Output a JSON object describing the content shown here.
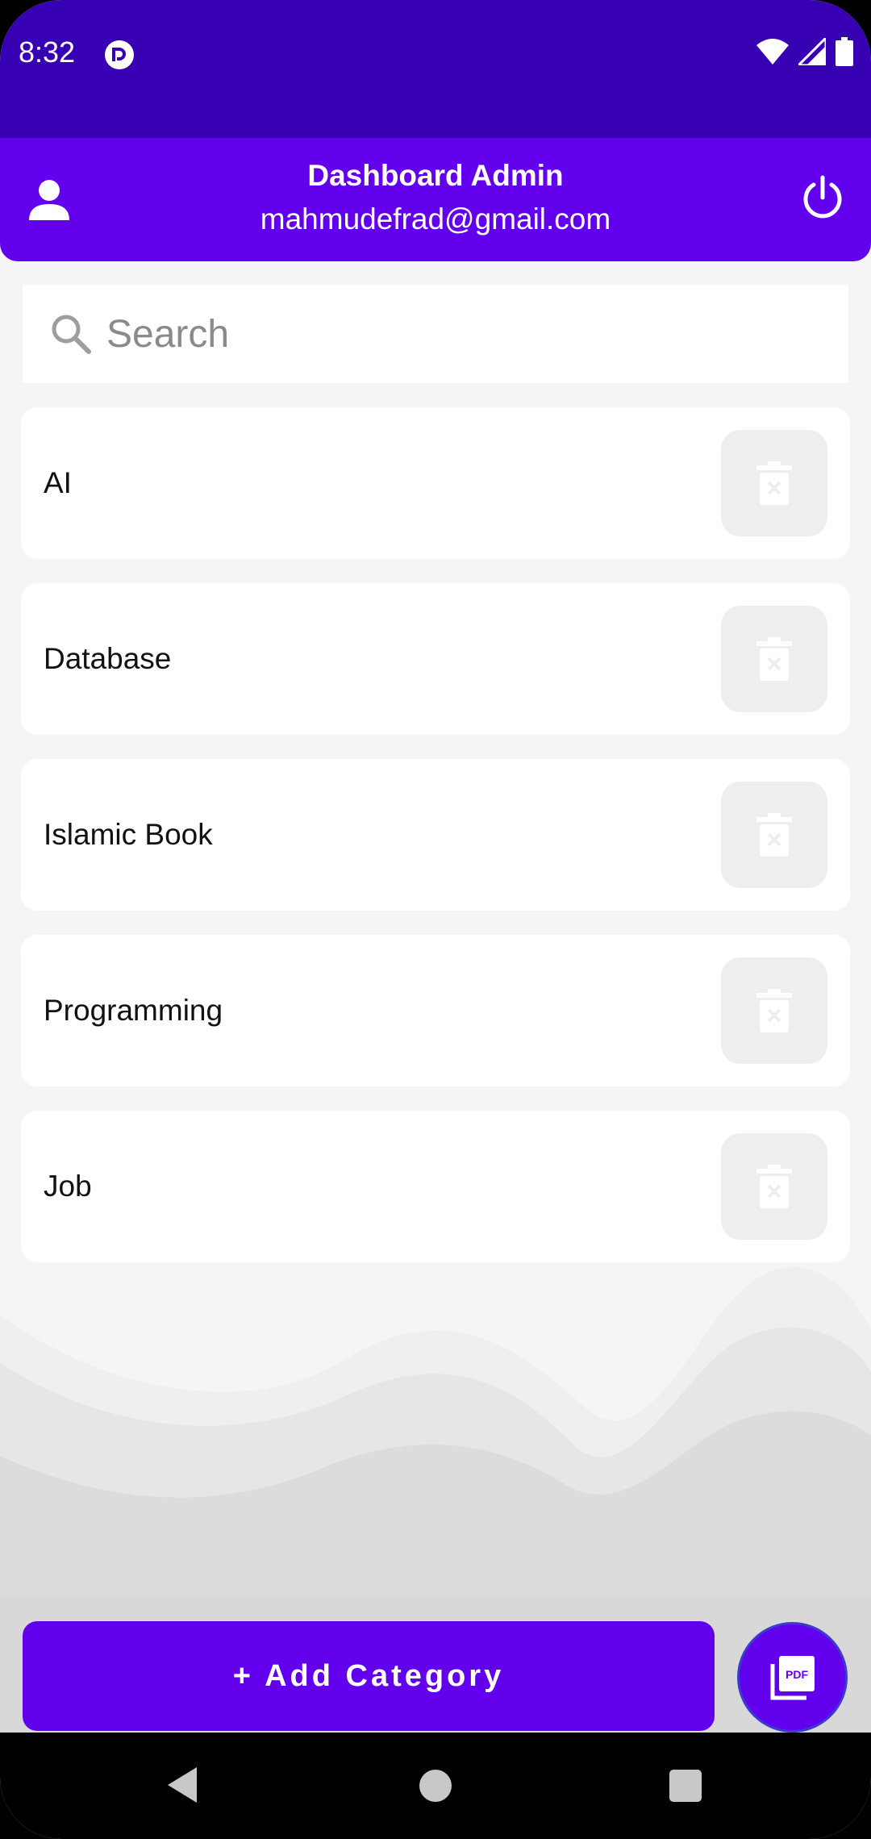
{
  "status_bar": {
    "time": "8:32"
  },
  "header": {
    "title": "Dashboard Admin",
    "email": "mahmudefrad@gmail.com",
    "left_icon": "person-icon",
    "right_icon": "power-icon"
  },
  "search": {
    "placeholder": "Search",
    "value": ""
  },
  "categories": [
    {
      "name": "AI"
    },
    {
      "name": "Database"
    },
    {
      "name": "Islamic Book"
    },
    {
      "name": "Programming"
    },
    {
      "name": "Job"
    }
  ],
  "actions": {
    "add_category_label": "+ Add Category",
    "pdf_icon": "pdf-icon"
  },
  "colors": {
    "status_bar": "#3700b3",
    "primary": "#6200ee",
    "background": "#f5f5f7",
    "delete_button_bg": "#eeeeee"
  }
}
